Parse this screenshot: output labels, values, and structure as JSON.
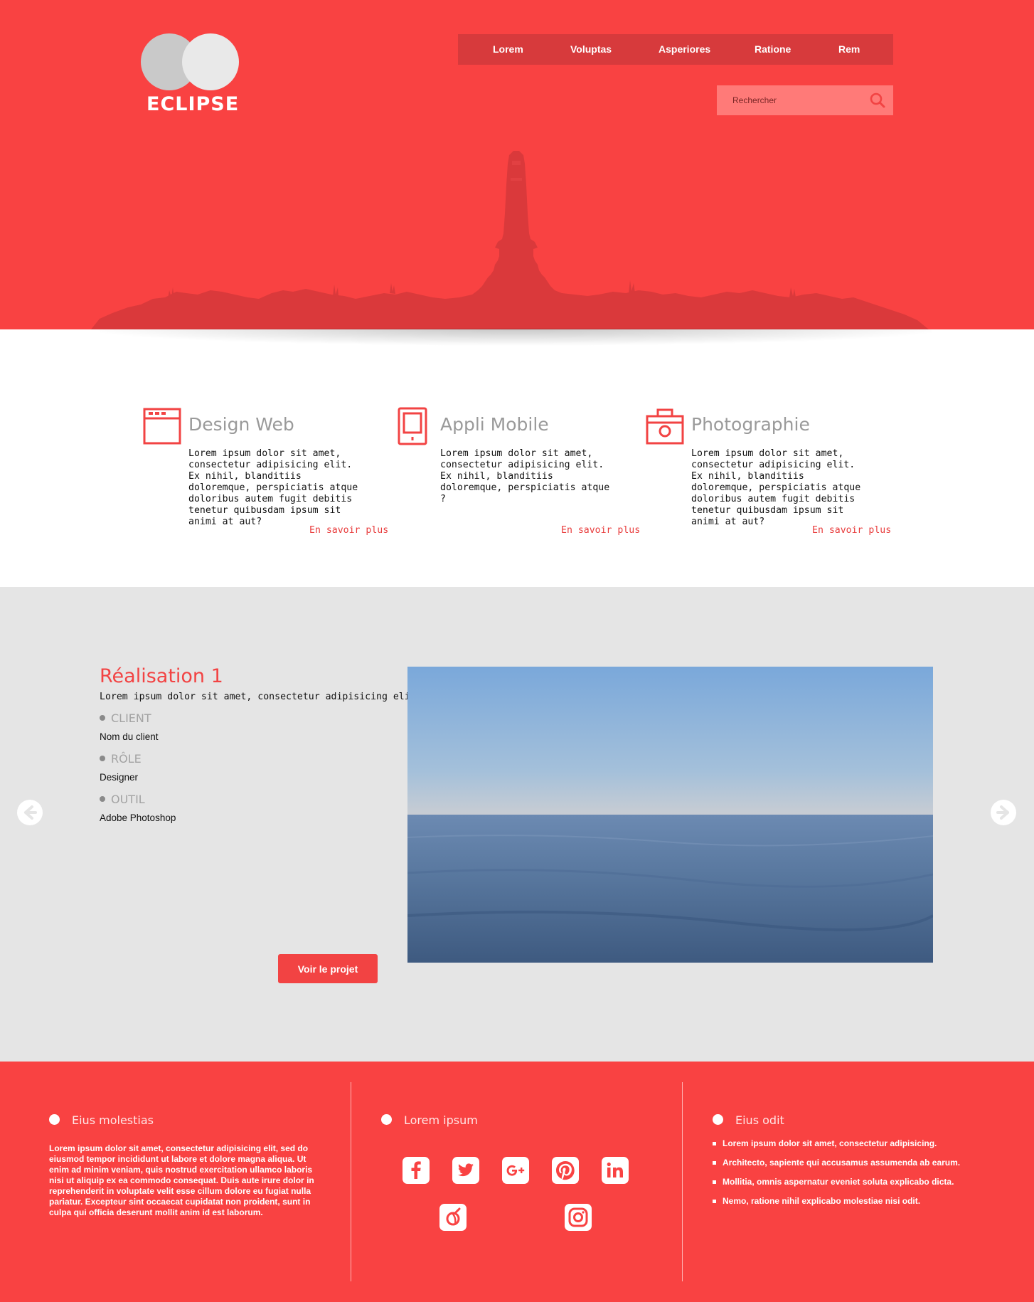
{
  "header": {
    "logo_text": "ECLIPSE",
    "nav": [
      "Lorem",
      "Voluptas",
      "Asperiores",
      "Ratione",
      "Rem"
    ],
    "search_placeholder": "Rechercher"
  },
  "services": [
    {
      "icon": "browser-window-icon",
      "title": "Design Web",
      "text": "Lorem ipsum dolor sit amet, consectetur adipisicing elit. Ex nihil, blanditiis doloremque, perspiciatis atque doloribus autem fugit debitis tenetur quibusdam ipsum sit animi at aut?",
      "link": "En savoir plus"
    },
    {
      "icon": "mobile-phone-icon",
      "title": "Appli Mobile",
      "text": "Lorem ipsum dolor sit amet, consectetur adipisicing elit. Ex nihil, blanditiis doloremque, perspiciatis atque ?",
      "link": "En savoir plus"
    },
    {
      "icon": "camera-icon",
      "title": "Photographie",
      "text": "Lorem ipsum dolor sit amet, consectetur adipisicing elit. Ex nihil, blanditiis doloremque, perspiciatis atque doloribus autem fugit debitis tenetur quibusdam ipsum sit animi at aut?",
      "link": "En savoir plus"
    }
  ],
  "portfolio": {
    "title": "Réalisation 1",
    "subtitle": "Lorem ipsum dolor sit amet, consectetur adipisicing elit.",
    "client_label": "CLIENT",
    "client_value": "Nom du client",
    "role_label": "RÔLE",
    "role_value": "Designer",
    "tool_label": "OUTIL",
    "tool_value": "Adobe Photoshop",
    "button": "Voir le projet"
  },
  "footer": {
    "col1_title": "Eius molestias",
    "col1_text": "Lorem ipsum dolor sit amet, consectetur adipisicing elit, sed do eiusmod tempor incididunt ut labore et dolore magna aliqua. Ut enim ad minim veniam, quis nostrud exercitation ullamco laboris nisi ut aliquip ex ea commodo consequat. Duis aute irure dolor in reprehenderit in voluptate velit esse cillum dolore eu fugiat nulla pariatur. Excepteur sint occaecat cupidatat non proident, sunt in culpa qui officia deserunt mollit anim id est laborum.",
    "col2_title": "Lorem ipsum",
    "social_icons": [
      "facebook-icon",
      "twitter-icon",
      "google-plus-icon",
      "pinterest-icon",
      "linkedin-icon",
      "dribbble-icon",
      "instagram-icon"
    ],
    "col3_title": "Eius odit",
    "col3_items": [
      "Lorem ipsum dolor sit amet, consectetur adipisicing.",
      "Architecto, sapiente qui accusamus assumenda ab earum.",
      "Mollitia, omnis aspernatur eveniet soluta explicabo dicta.",
      "Nemo, ratione nihil explicabo molestiae nisi odit."
    ]
  },
  "colors": {
    "primary_red": "#f94242",
    "nav_bg": "#d73a3c",
    "search_bg": "#ff7a78",
    "portfolio_bg": "#e5e5e5",
    "accent_text": "#f24343"
  }
}
